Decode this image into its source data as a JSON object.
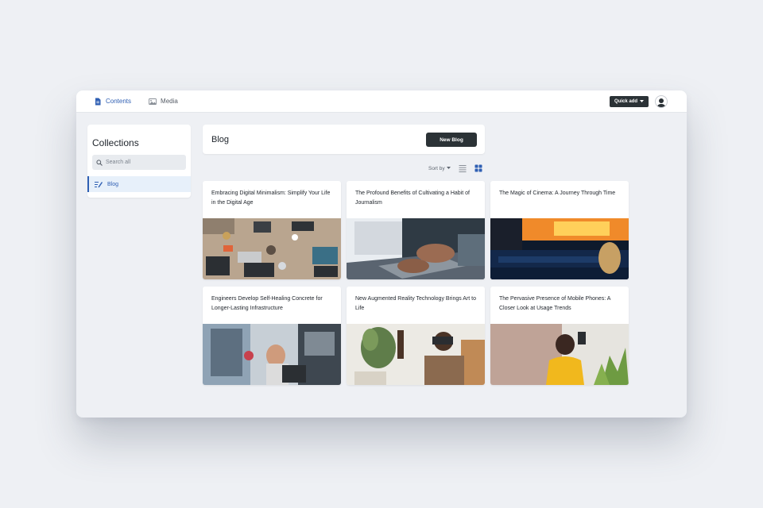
{
  "nav": {
    "tabs": [
      {
        "label": "Contents",
        "icon": "document-icon",
        "active": true
      },
      {
        "label": "Media",
        "icon": "image-icon",
        "active": false
      }
    ],
    "quick_add_label": "Quick add"
  },
  "sidebar": {
    "title": "Collections",
    "search_placeholder": "Search all",
    "items": [
      {
        "label": "Blog",
        "icon": "blog-icon",
        "active": true
      }
    ]
  },
  "main": {
    "title": "Blog",
    "new_button_label": "New Blog",
    "sort_label": "Sort by",
    "view_mode": "grid",
    "cards": [
      {
        "title": "Embracing Digital Minimalism: Simplify Your Life in the Digital Age"
      },
      {
        "title": "The Profound Benefits of Cultivating a Habit of Journalism"
      },
      {
        "title": "The Magic of Cinema: A Journey Through Time"
      },
      {
        "title": "Engineers Develop Self-Healing Concrete for Longer-Lasting Infrastructure"
      },
      {
        "title": "New Augmented Reality Technology Brings Art to Life"
      },
      {
        "title": "The Pervasive Presence of Mobile Phones: A Closer Look at Usage Trends"
      }
    ]
  },
  "colors": {
    "accent": "#2f5fb3",
    "dark_button": "#2b3236",
    "background": "#eef0f4"
  }
}
